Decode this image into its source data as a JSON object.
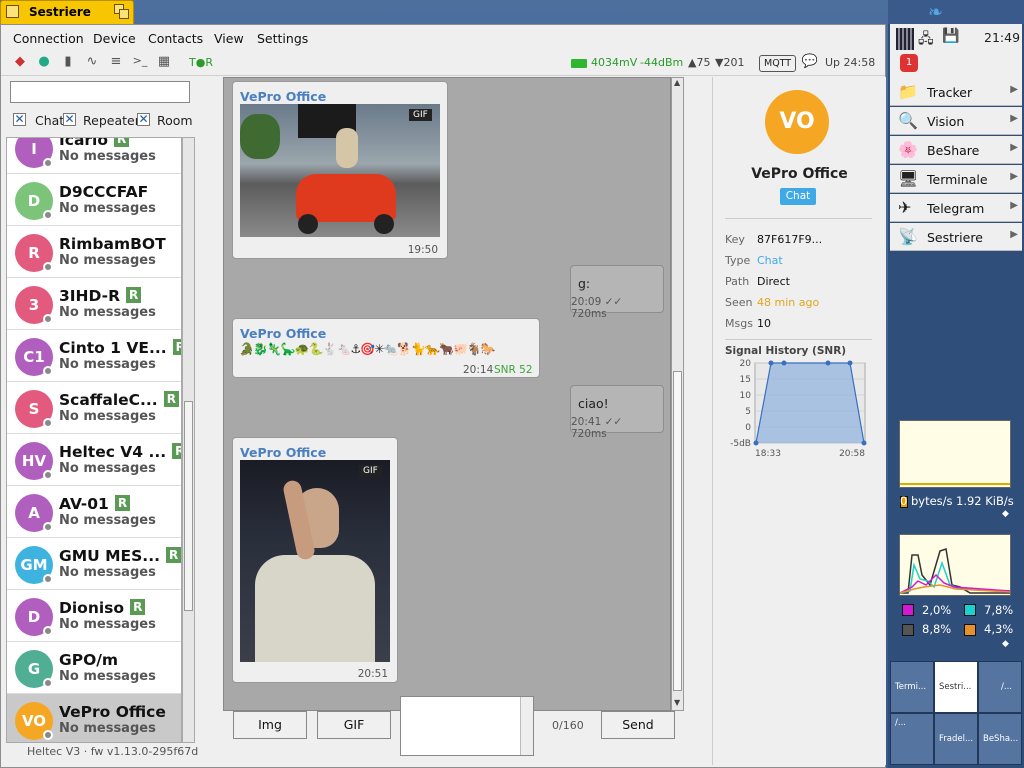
{
  "window": {
    "title": "Sestriere"
  },
  "menu": [
    "Connection",
    "Device",
    "Contacts",
    "View",
    "Settings"
  ],
  "toolbar": {
    "tor_label": "T●R",
    "voltage": "4034mV",
    "rssi": "-44dBm",
    "up_count": "▲75",
    "down_count": "▼201",
    "mqtt": "MQTT",
    "uptime": "Up  24:58"
  },
  "filters": {
    "search_placeholder": "",
    "chat": "Chat",
    "repeater": "Repeater",
    "room": "Room"
  },
  "contacts": [
    {
      "initials": "I",
      "name": "Icario",
      "msg": "No messages",
      "repeater": true,
      "color": "#b05fbf"
    },
    {
      "initials": "D",
      "name": "D9CCCFAF",
      "msg": "No messages",
      "repeater": false,
      "color": "#7cc47a"
    },
    {
      "initials": "R",
      "name": "RimbamBOT",
      "msg": "No messages",
      "repeater": false,
      "color": "#e25a7e"
    },
    {
      "initials": "3",
      "name": "3IHD-R",
      "msg": "No messages",
      "repeater": true,
      "color": "#e25a7e"
    },
    {
      "initials": "C1",
      "name": "Cinto 1 VE...",
      "msg": "No messages",
      "repeater": true,
      "color": "#b05fbf"
    },
    {
      "initials": "S",
      "name": "ScaffaleC...",
      "msg": "No messages",
      "repeater": true,
      "color": "#e25a7e"
    },
    {
      "initials": "HV",
      "name": "Heltec V4 ...",
      "msg": "No messages",
      "repeater": true,
      "color": "#b05fbf"
    },
    {
      "initials": "A",
      "name": "AV-01",
      "msg": "No messages",
      "repeater": true,
      "color": "#b05fbf"
    },
    {
      "initials": "GM",
      "name": "GMU MES...",
      "msg": "No messages",
      "repeater": true,
      "color": "#3fb3e0"
    },
    {
      "initials": "D",
      "name": "Dioniso",
      "msg": "No messages",
      "repeater": true,
      "color": "#b05fbf"
    },
    {
      "initials": "G",
      "name": "GPO/m",
      "msg": "No messages",
      "repeater": false,
      "color": "#4fae94"
    },
    {
      "initials": "VO",
      "name": "VePro Office",
      "msg": "No messages",
      "repeater": false,
      "color": "#f5a623",
      "selected": true
    }
  ],
  "repeater_badge": "R",
  "firmware": "Heltec V3 · fw v1.13.0-295f67d",
  "messages": {
    "m1": {
      "sender": "VePro Office",
      "gif": "GIF",
      "time": "19:50"
    },
    "m2": {
      "text": "g:",
      "time": "20:09 ✓✓ 720ms"
    },
    "m3": {
      "sender": "VePro Office",
      "emoji": "🐊🐉🦎🦕🐢🐍🐇🐁⚓🎯✳🐀🐕🐈🐆🐂🐖🐐🐎",
      "time": "20:14",
      "snr": "SNR 52"
    },
    "m4": {
      "text": "ciao!",
      "time": "20:41 ✓✓ 720ms"
    },
    "m5": {
      "sender": "VePro Office",
      "gif": "GIF",
      "time": "20:51"
    }
  },
  "composer": {
    "img": "Img",
    "gif": "GIF",
    "counter": "0/160",
    "send": "Send"
  },
  "details": {
    "initials": "VO",
    "name": "VePro Office",
    "type_badge": "Chat",
    "key_label": "Key",
    "key": "87F617F9...",
    "type_label": "Type",
    "type": "Chat",
    "path_label": "Path",
    "path": "Direct",
    "seen_label": "Seen",
    "seen": "48 min ago",
    "msgs_label": "Msgs",
    "msgs": "10",
    "signal_title": "Signal History (SNR)"
  },
  "chart_data": {
    "type": "line",
    "title": "Signal History (SNR)",
    "x": [
      "18:33",
      "",
      "",
      "",
      "",
      "20:58"
    ],
    "series": [
      {
        "values": [
          -5,
          20,
          20,
          20,
          20,
          -5
        ]
      }
    ],
    "yticks": [
      "20",
      "15",
      "10",
      "5",
      "0",
      "-5dB"
    ],
    "xticks": [
      "18:33",
      "20:58"
    ],
    "ylim": [
      -5,
      20
    ]
  },
  "sidepanel": {
    "clock": "21:49",
    "notif": "1",
    "apps": [
      "Tracker",
      "Vision",
      "BeShare",
      "Terminale",
      "Telegram",
      "Sestriere"
    ],
    "net_in": "0 bytes/s",
    "net_out": "1.92 KiB/s",
    "cpu": [
      "2,0%",
      "7,8%",
      "8,8%",
      "4,3%"
    ],
    "cpu_colors": [
      "#d21ad2",
      "#1ad2d2",
      "#555555",
      "#e89030"
    ],
    "workspaces": [
      "Termi...",
      "Sestri...",
      "/...",
      "/...",
      "Fradel...",
      "BeSha..."
    ]
  }
}
